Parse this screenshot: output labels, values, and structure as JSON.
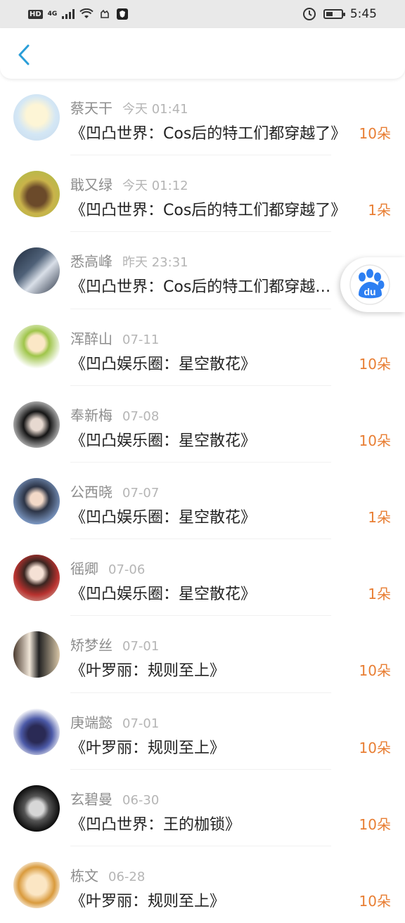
{
  "status_bar": {
    "hd": "HD",
    "network": "4G",
    "time": "5:45"
  },
  "colors": {
    "amount": "#e87e33",
    "back": "#2a9ed8",
    "baidu": "#2d7ff2"
  },
  "header": {
    "back_icon": "chevron-left-icon"
  },
  "items": [
    {
      "name": "蔡天干",
      "time": "今天 01:41",
      "title": "《凹凸世界：Cos后的特工们都穿越了》",
      "amount": "10朵"
    },
    {
      "name": "戢又绿",
      "time": "今天 01:12",
      "title": "《凹凸世界：Cos后的特工们都穿越了》",
      "amount": "1朵"
    },
    {
      "name": "悉高峰",
      "time": "昨天 23:31",
      "title": "《凹凸世界：Cos后的特工们都穿越了》",
      "amount": ""
    },
    {
      "name": "浑醉山",
      "time": "07-11",
      "title": "《凹凸娱乐圈：星空散花》",
      "amount": "10朵"
    },
    {
      "name": "奉新梅",
      "time": "07-08",
      "title": "《凹凸娱乐圈：星空散花》",
      "amount": "10朵"
    },
    {
      "name": "公西晓",
      "time": "07-07",
      "title": "《凹凸娱乐圈：星空散花》",
      "amount": "1朵"
    },
    {
      "name": "徭卿",
      "time": "07-06",
      "title": "《凹凸娱乐圈：星空散花》",
      "amount": "1朵"
    },
    {
      "name": "矫梦丝",
      "time": "07-01",
      "title": "《叶罗丽：规则至上》",
      "amount": "10朵"
    },
    {
      "name": "庚端懿",
      "time": "07-01",
      "title": "《叶罗丽：规则至上》",
      "amount": "10朵"
    },
    {
      "name": "玄碧曼",
      "time": "06-30",
      "title": "《凹凸世界：王的枷锁》",
      "amount": "10朵"
    },
    {
      "name": "栋文",
      "time": "06-28",
      "title": "《叶罗丽：规则至上》",
      "amount": "10朵"
    }
  ]
}
